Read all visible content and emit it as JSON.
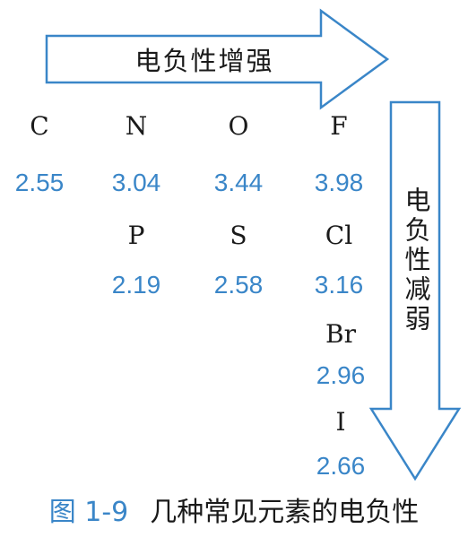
{
  "arrows": {
    "horizontal_label": "电负性增强",
    "vertical_label": "电负性减弱"
  },
  "elements": {
    "row1": [
      {
        "symbol": "C",
        "value": "2.55"
      },
      {
        "symbol": "N",
        "value": "3.04"
      },
      {
        "symbol": "O",
        "value": "3.44"
      },
      {
        "symbol": "F",
        "value": "3.98"
      }
    ],
    "row2": [
      {
        "symbol": "P",
        "value": "2.19"
      },
      {
        "symbol": "S",
        "value": "2.58"
      },
      {
        "symbol": "Cl",
        "value": "3.16"
      }
    ],
    "row3": [
      {
        "symbol": "Br",
        "value": "2.96"
      }
    ],
    "row4": [
      {
        "symbol": "I",
        "value": "2.66"
      }
    ]
  },
  "caption": {
    "figure_number": "图 1-9",
    "title": "几种常见元素的电负性"
  },
  "colors": {
    "accent_blue": "#3a86c8",
    "text_dark": "#1a1a1a"
  }
}
